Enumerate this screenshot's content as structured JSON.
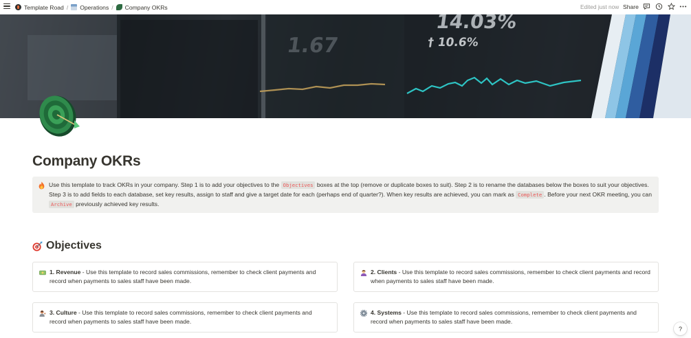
{
  "topbar": {
    "breadcrumbs": [
      {
        "label": "Template Road",
        "icon": "template-road-logo-icon"
      },
      {
        "label": "Operations",
        "icon": "operations-page-icon"
      },
      {
        "label": "Company OKRs",
        "icon": "okr-leaf-icon"
      }
    ],
    "separator": "/",
    "edited": "Edited just now",
    "share_label": "Share",
    "icons": [
      "comments-icon",
      "history-icon",
      "favorite-star-icon",
      "more-icon"
    ]
  },
  "page": {
    "title": "Company OKRs",
    "icon": "target-bullseye-icon"
  },
  "callout": {
    "icon": "fire-icon",
    "t1": "Use this template to track OKRs in your company. Step 1 is to add your objectives to the ",
    "code1": "Objectives",
    "t2": " boxes at the top (remove or duplicate boxes to suit). Step 2 is to rename the databases below the boxes to suit your objectives. Step 3 is to add fields to each database, set key results, assign to staff and give a target date for each (perhaps end of quarter?). When key results are achieved, you can mark as ",
    "code2": "Complete",
    "t3": ". Before your next OKR meeting, you can ",
    "code3": "Archive",
    "t4": " previously achieved key results."
  },
  "objectives": {
    "heading": "Objectives",
    "icon": "dart-target-icon",
    "cards": [
      {
        "icon": "money-icon",
        "title": "1. Revenue",
        "body": " - Use this template to record sales commissions, remember to check client payments and record when payments to sales staff have been made."
      },
      {
        "icon": "person-icon",
        "title": "2. Clients",
        "body": " - Use this template to record sales commissions, remember to check client payments and record when payments to sales staff have been made."
      },
      {
        "icon": "person-tipping-hand-icon",
        "title": "3. Culture",
        "body": " - Use this template to record sales commissions, remember to check client payments and record when payments to sales staff have been made."
      },
      {
        "icon": "gear-icon",
        "title": "4. Systems",
        "body": " - Use this template to record sales commissions, remember to check client payments and record when payments to sales staff have been made."
      }
    ]
  },
  "cover": {
    "ticker_1": "14.03%",
    "ticker_2": "† 10.6%",
    "ticker_3": "1.67"
  },
  "help": "?",
  "colors": {
    "text": "#37352f",
    "muted": "#9b9a97",
    "callout_bg": "#f1f1ef",
    "code_red": "#eb5757",
    "cover_line_teal": "#2ec4c4",
    "cover_line_gold": "#c9a45c"
  }
}
